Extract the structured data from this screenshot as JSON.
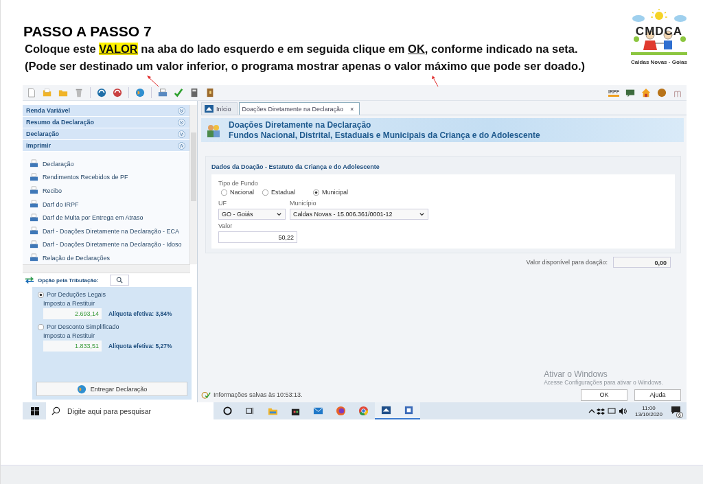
{
  "heading": "PASSO A PASSO 7",
  "instructions": [
    [
      {
        "text": "Coloque este ",
        "kind": "plain"
      },
      {
        "text": "VALOR",
        "kind": "highlight"
      },
      {
        "text": " na aba do lado esquerdo e em seguida clique em ",
        "kind": "plain"
      },
      {
        "text": "OK",
        "kind": "underline"
      },
      {
        "text": ", conforme indicado na seta.",
        "kind": "plain"
      }
    ],
    [
      {
        "text": "(Pode ser destinado um valor inferior, o programa mostrar apenas o valor máximo que pode ser doado.)",
        "kind": "plain"
      }
    ]
  ],
  "logo": {
    "title": "CMDCA",
    "caption": "Caldas Novas - Goias"
  },
  "app": {
    "irpf_badge": "IRPF",
    "sidebar": {
      "sections": [
        {
          "label": "Renda Variável",
          "expanded": false
        },
        {
          "label": "Resumo da Declaração",
          "expanded": false
        },
        {
          "label": "Declaração",
          "expanded": false
        },
        {
          "label": "Imprimir",
          "expanded": true,
          "items": [
            "Declaração",
            "Rendimentos Recebidos de PF",
            "Recibo",
            "Darf do IRPF",
            "Darf de Multa por Entrega em Atraso",
            "Darf - Doações Diretamente na Declaração - ECA",
            "Darf - Doações Diretamente na Declaração - Idoso",
            "Relação de Declarações"
          ]
        }
      ]
    },
    "tributacao": {
      "title": "Opção pela Tributação:",
      "options": [
        {
          "label": "Por Deduções Legais",
          "selected": true,
          "caption": "Imposto a Restituir",
          "amount": "2.693,14",
          "rate": "Alíquota efetiva: 3,84%"
        },
        {
          "label": "Por Desconto Simplificado",
          "selected": false,
          "caption": "Imposto a Restituir",
          "amount": "1.833,51",
          "rate": "Alíquota efetiva: 5,27%"
        }
      ],
      "button": "Entregar Declaração"
    },
    "tabs": [
      {
        "label": "Início",
        "selected": false
      },
      {
        "label": "Doações Diretamente na Declaração",
        "selected": true,
        "close": "×"
      }
    ],
    "banner": {
      "title": "Doações Diretamente na Declaração",
      "subtitle": "Fundos Nacional, Distrital, Estaduais e Municipais da Criança e do Adolescente"
    },
    "form": {
      "section_title": "Dados da Doação - Estatuto da Criança e do Adolescente",
      "fund_label": "Tipo de Fundo",
      "fund_types": [
        {
          "label": "Nacional",
          "selected": false
        },
        {
          "label": "Estadual",
          "selected": false
        },
        {
          "label": "Municipal",
          "selected": true
        }
      ],
      "uf": {
        "label": "UF",
        "value": "GO - Goiás"
      },
      "municipio": {
        "label": "Município",
        "value": "Caldas Novas - 15.006.361/0001-12"
      },
      "valor": {
        "label": "Valor",
        "value": "50,22"
      }
    },
    "available": {
      "label": "Valor disponível para doação:",
      "value": "0,00"
    },
    "activation": {
      "title": "Ativar o Windows",
      "text": "Acesse Configurações para ativar o Windows."
    },
    "status": "Informações salvas às 10:53:13.",
    "buttons": [
      "OK",
      "Ajuda"
    ],
    "taskbar": {
      "search_placeholder": "Digite aqui para pesquisar",
      "apps": [
        {
          "kind": "cortana",
          "active": false
        },
        {
          "kind": "taskview",
          "active": false
        },
        {
          "kind": "explorer",
          "active": false
        },
        {
          "kind": "store",
          "active": false
        },
        {
          "kind": "mail",
          "active": false
        },
        {
          "kind": "firefox",
          "active": false
        },
        {
          "kind": "chrome",
          "active": false
        },
        {
          "kind": "irpf",
          "active": true
        },
        {
          "kind": "document",
          "active": true
        }
      ],
      "time": "11:00",
      "date": "13/10/2020",
      "notifications": "6"
    }
  }
}
